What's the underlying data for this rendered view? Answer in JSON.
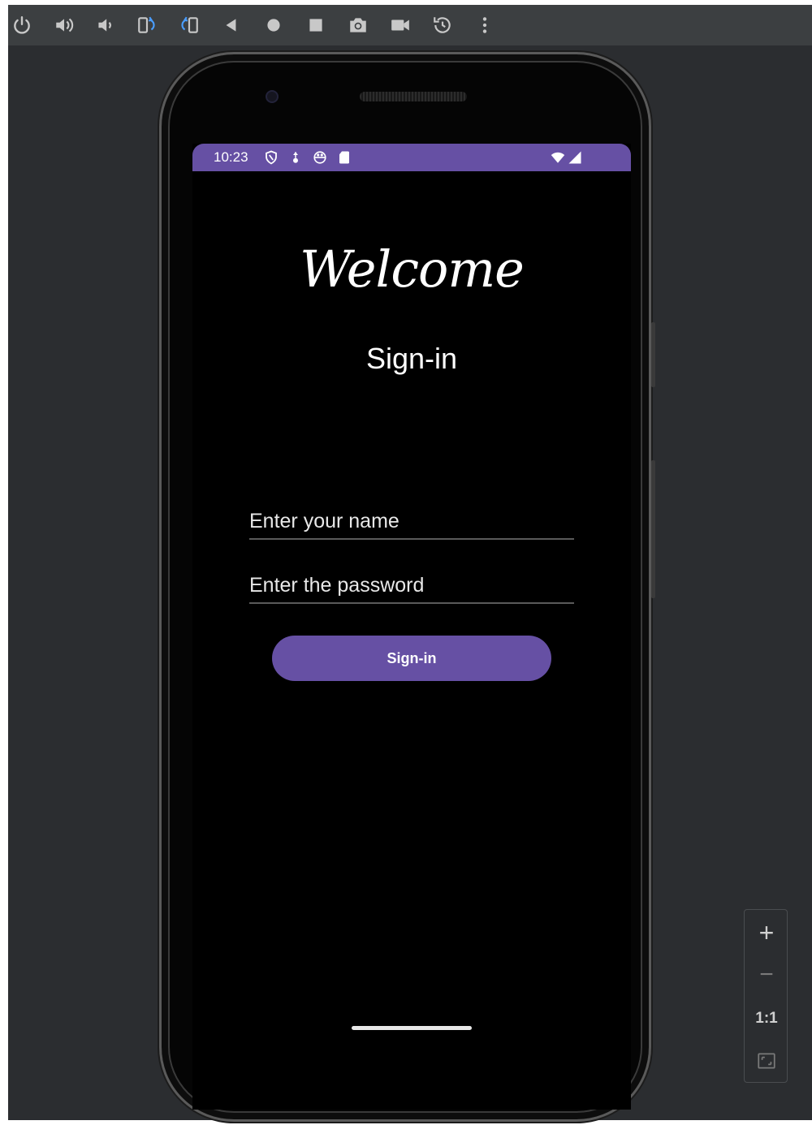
{
  "status_bar": {
    "time": "10:23"
  },
  "app": {
    "welcome_text": "Welcome",
    "subtitle": "Sign-in",
    "name_field": {
      "placeholder": "Enter your name",
      "value": ""
    },
    "password_field": {
      "placeholder": "Enter the password",
      "value": ""
    },
    "signin_button_label": "Sign-in"
  },
  "zoom_controls": {
    "zoom_in": "+",
    "zoom_out": "−",
    "actual_size": "1:1"
  },
  "colors": {
    "accent": "#6650a4",
    "toolbar": "#3c3f41",
    "background": "#2b2d30"
  }
}
